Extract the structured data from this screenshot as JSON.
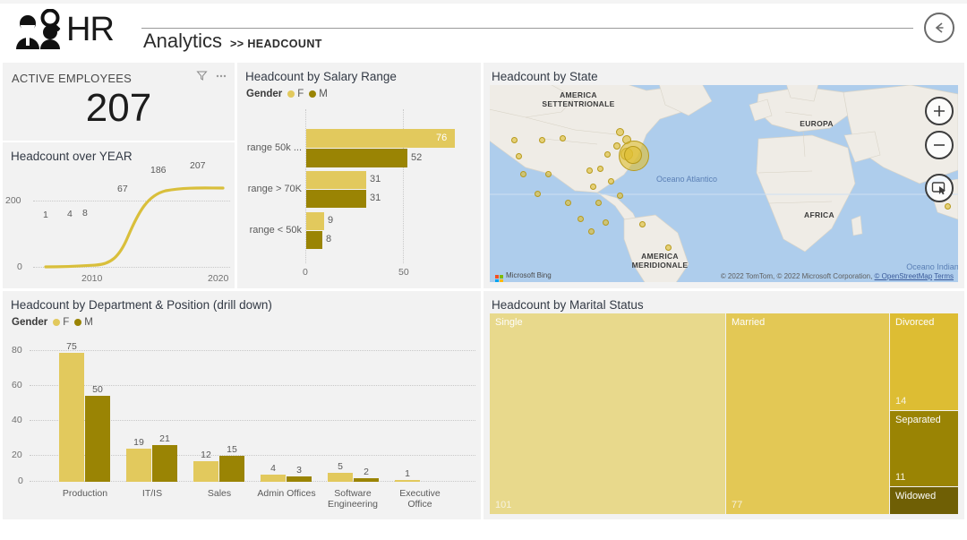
{
  "header": {
    "logo_text": "HR",
    "logo_icon": "people-search-icon",
    "analytics": "Analytics",
    "breadcrumb": ">> HEADCOUNT",
    "back_button": "back-arrow-icon"
  },
  "kpi": {
    "label": "ACTIVE EMPLOYEES",
    "value": "207",
    "filter_icon": "filter-icon",
    "more_icon": "ellipsis-icon"
  },
  "colors": {
    "female": "#E2C95D",
    "male": "#9A8404",
    "line": "#D9BF3B",
    "panel_bg": "#F2F2F2",
    "page_bg": "#FFFFFF"
  },
  "legend": {
    "title": "Gender",
    "female": "F",
    "male": "M"
  },
  "line_chart": {
    "title": "Headcount over YEAR",
    "y_ticks": [
      "0",
      "200"
    ],
    "x_ticks": [
      "2010",
      "2020"
    ],
    "labels": [
      "1",
      "4",
      "8",
      "67",
      "186",
      "207"
    ]
  },
  "salary_chart": {
    "title": "Headcount by Salary Range",
    "x_ticks": [
      "0",
      "50"
    ]
  },
  "map": {
    "title": "Headcount by State",
    "labels": [
      "AMERICA SETTENTRIONALE",
      "EUROPA",
      "AFRICA",
      "AMERICA MERIDIONALE"
    ],
    "ocean_labels": [
      "Oceano Atlantico",
      "Oceano Indiano"
    ],
    "bing_text": "Microsoft Bing",
    "attribution": "© 2022 TomTom, © 2022 Microsoft Corporation,",
    "attribution_osm": "© OpenStreetMap",
    "attribution_terms": "Terms",
    "zoom_in": "plus-icon",
    "zoom_out": "minus-icon",
    "select_tool": "select-tool-icon"
  },
  "dept_chart": {
    "title": "Headcount by Department & Position (drill down)",
    "y_ticks": [
      "0",
      "20",
      "40",
      "60",
      "80"
    ]
  },
  "treemap": {
    "title": "Headcount by Marital Status"
  },
  "chart_data": [
    {
      "type": "line",
      "title": "Headcount over YEAR",
      "xlabel": "",
      "ylabel": "",
      "x": [
        2006,
        2008,
        2009,
        2010,
        2012,
        2014,
        2016,
        2018
      ],
      "values": [
        1,
        4,
        8,
        8,
        67,
        186,
        207,
        207
      ],
      "point_labels": [
        "1",
        "4",
        "8",
        "67",
        "186",
        "207"
      ],
      "ylim": [
        0,
        230
      ],
      "y_ticks": [
        0,
        200
      ],
      "x_ticks": [
        2010,
        2020
      ],
      "grid": true,
      "legend": "none"
    },
    {
      "type": "bar",
      "orientation": "horizontal",
      "title": "Headcount by Salary Range",
      "categories": [
        "range 50k ...",
        "range > 70K",
        "range < 50k"
      ],
      "series": [
        {
          "name": "F",
          "values": [
            76,
            31,
            9
          ],
          "color": "#E2C95D"
        },
        {
          "name": "M",
          "values": [
            52,
            31,
            8
          ],
          "color": "#9A8404"
        }
      ],
      "legend": "Gender",
      "xlim": [
        0,
        85
      ],
      "x_ticks": [
        0,
        50
      ],
      "grid": true
    },
    {
      "type": "bar",
      "orientation": "vertical",
      "title": "Headcount by Department & Position (drill down)",
      "categories": [
        "Production",
        "IT/IS",
        "Sales",
        "Admin Offices",
        "Software Engineering",
        "Executive Office"
      ],
      "series": [
        {
          "name": "F",
          "values": [
            75,
            19,
            12,
            4,
            5,
            1
          ],
          "color": "#E2C95D"
        },
        {
          "name": "M",
          "values": [
            50,
            21,
            15,
            3,
            2,
            0
          ],
          "color": "#9A8404"
        }
      ],
      "legend": "Gender",
      "ylim": [
        0,
        85
      ],
      "y_ticks": [
        0,
        20,
        40,
        60,
        80
      ],
      "grid": true
    },
    {
      "type": "treemap",
      "title": "Headcount by Marital Status",
      "categories": [
        "Single",
        "Married",
        "Divorced",
        "Separated",
        "Widowed"
      ],
      "values": [
        101,
        77,
        14,
        11,
        4
      ],
      "colors": [
        "#E8D98C",
        "#E3C855",
        "#DDBD33",
        "#9A8404",
        "#6F5F05"
      ]
    },
    {
      "type": "scatter",
      "subtype": "bubble-map",
      "title": "Headcount by State",
      "description": "Bubble map of employee counts by US state, largest cluster in the Northeast (Massachusetts)."
    }
  ]
}
